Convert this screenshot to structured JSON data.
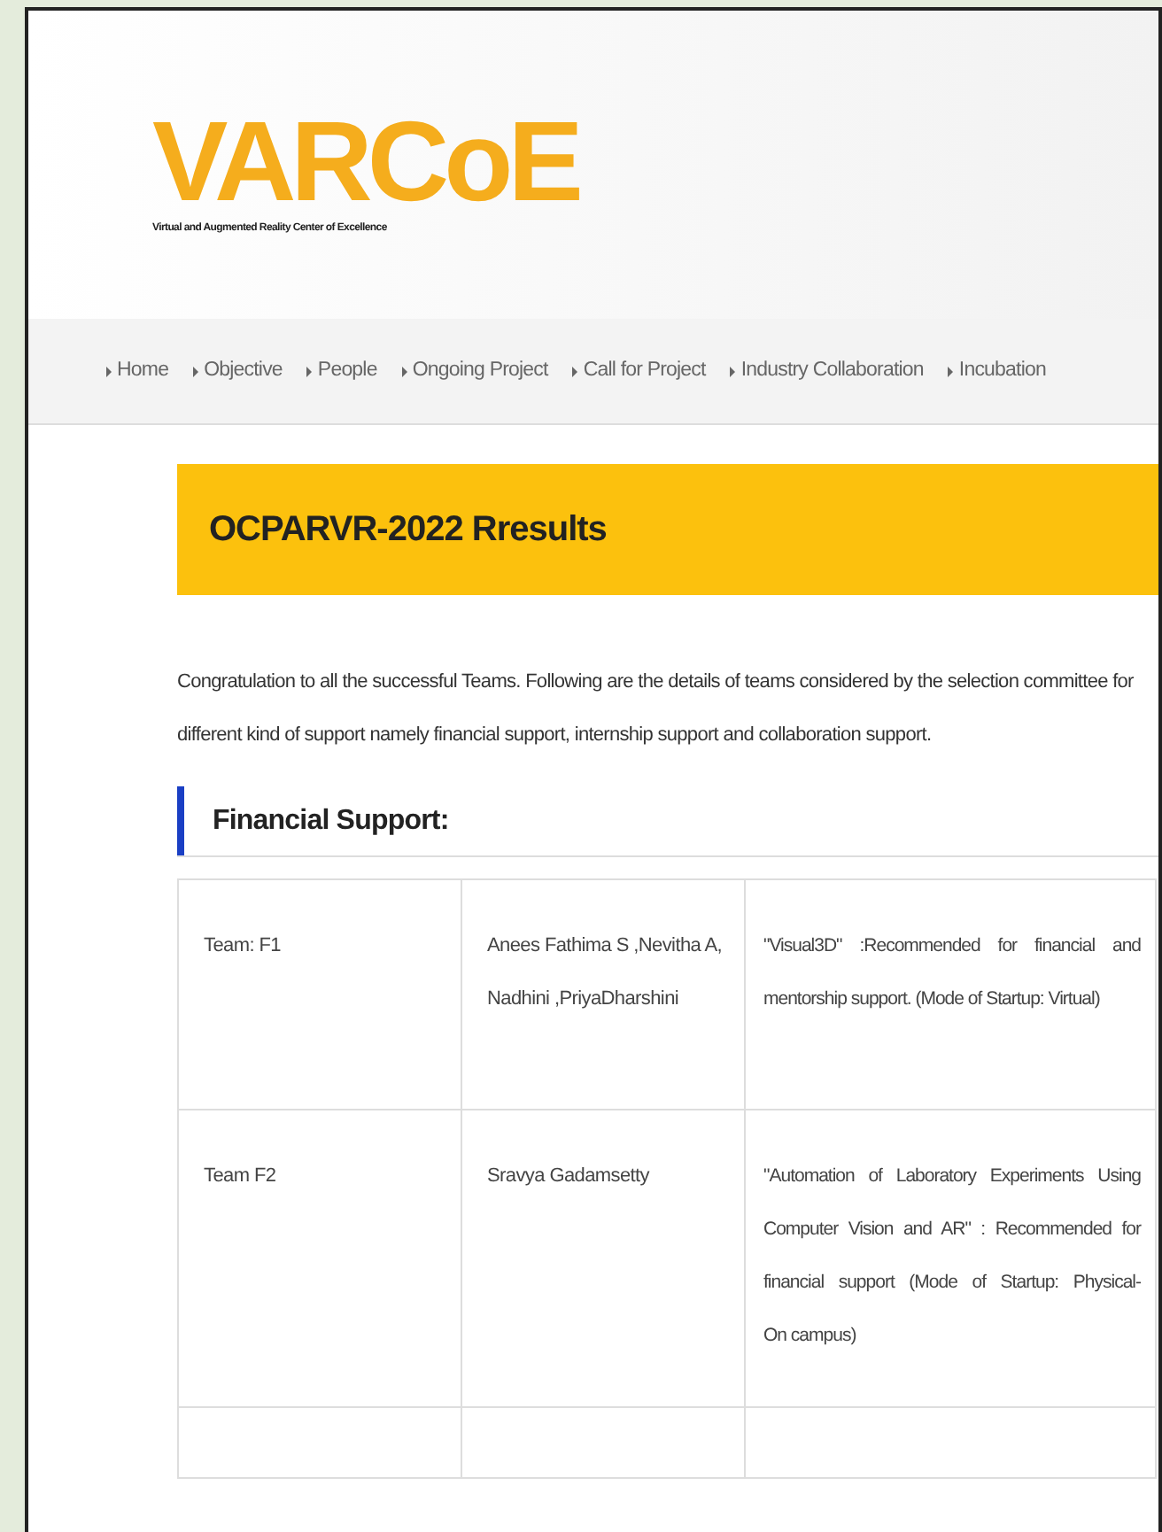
{
  "logo": {
    "mark": "VARCoE",
    "tagline": "Virtual and Augmented Reality Center of Excellence"
  },
  "nav": [
    {
      "label": "Home"
    },
    {
      "label": "Objective"
    },
    {
      "label": "People"
    },
    {
      "label": "Ongoing Project"
    },
    {
      "label": "Call for Project"
    },
    {
      "label": "Industry Collaboration"
    },
    {
      "label": "Incubation"
    }
  ],
  "page_title": "OCPARVR-2022 Rresults",
  "intro_lines": [
    "Congratulation to all the successful Teams. Following are the details of teams considered by the selection committee for",
    "different kind of support namely financial support, internship support and collaboration support."
  ],
  "section_heading": "Financial Support:",
  "table": {
    "rows": [
      {
        "team": "Team: F1",
        "members": [
          "Anees Fathima S ,Nevitha A,",
          "Nadhini ,PriyaDharshini"
        ],
        "details": [
          "\"Visual3D\" :Recommended for financial and",
          "mentorship support. (Mode of Startup: Virtual)"
        ]
      },
      {
        "team": "Team F2",
        "members": [
          "Sravya Gadamsetty"
        ],
        "details": [
          "\"Automation of Laboratory Experiments Using",
          "Computer Vision and AR\" : Recommended for",
          "financial support (Mode of Startup: Physical-",
          "On campus)"
        ]
      }
    ]
  }
}
